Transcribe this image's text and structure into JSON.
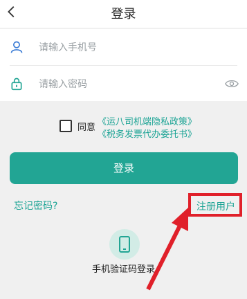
{
  "header": {
    "title": "登录",
    "back_icon": "chevron-left-icon"
  },
  "form": {
    "phone_placeholder": "请输入手机号",
    "password_placeholder": "请输入密码",
    "user_icon": "user-icon",
    "lock_icon": "lock-icon",
    "eye_icon": "eye-icon"
  },
  "agreement": {
    "checked": false,
    "label": "同意",
    "link1": "《运八司机端隐私政策》",
    "link2": "《税务发票代办委托书》"
  },
  "login_button": "登录",
  "forgot_password": "忘记密码?",
  "register": "注册用户",
  "sms_login": {
    "label": "手机验证码登录",
    "icon": "phone-icon"
  },
  "colors": {
    "accent": "#22a594",
    "link": "#1aa394",
    "highlight": "#e0202a"
  }
}
